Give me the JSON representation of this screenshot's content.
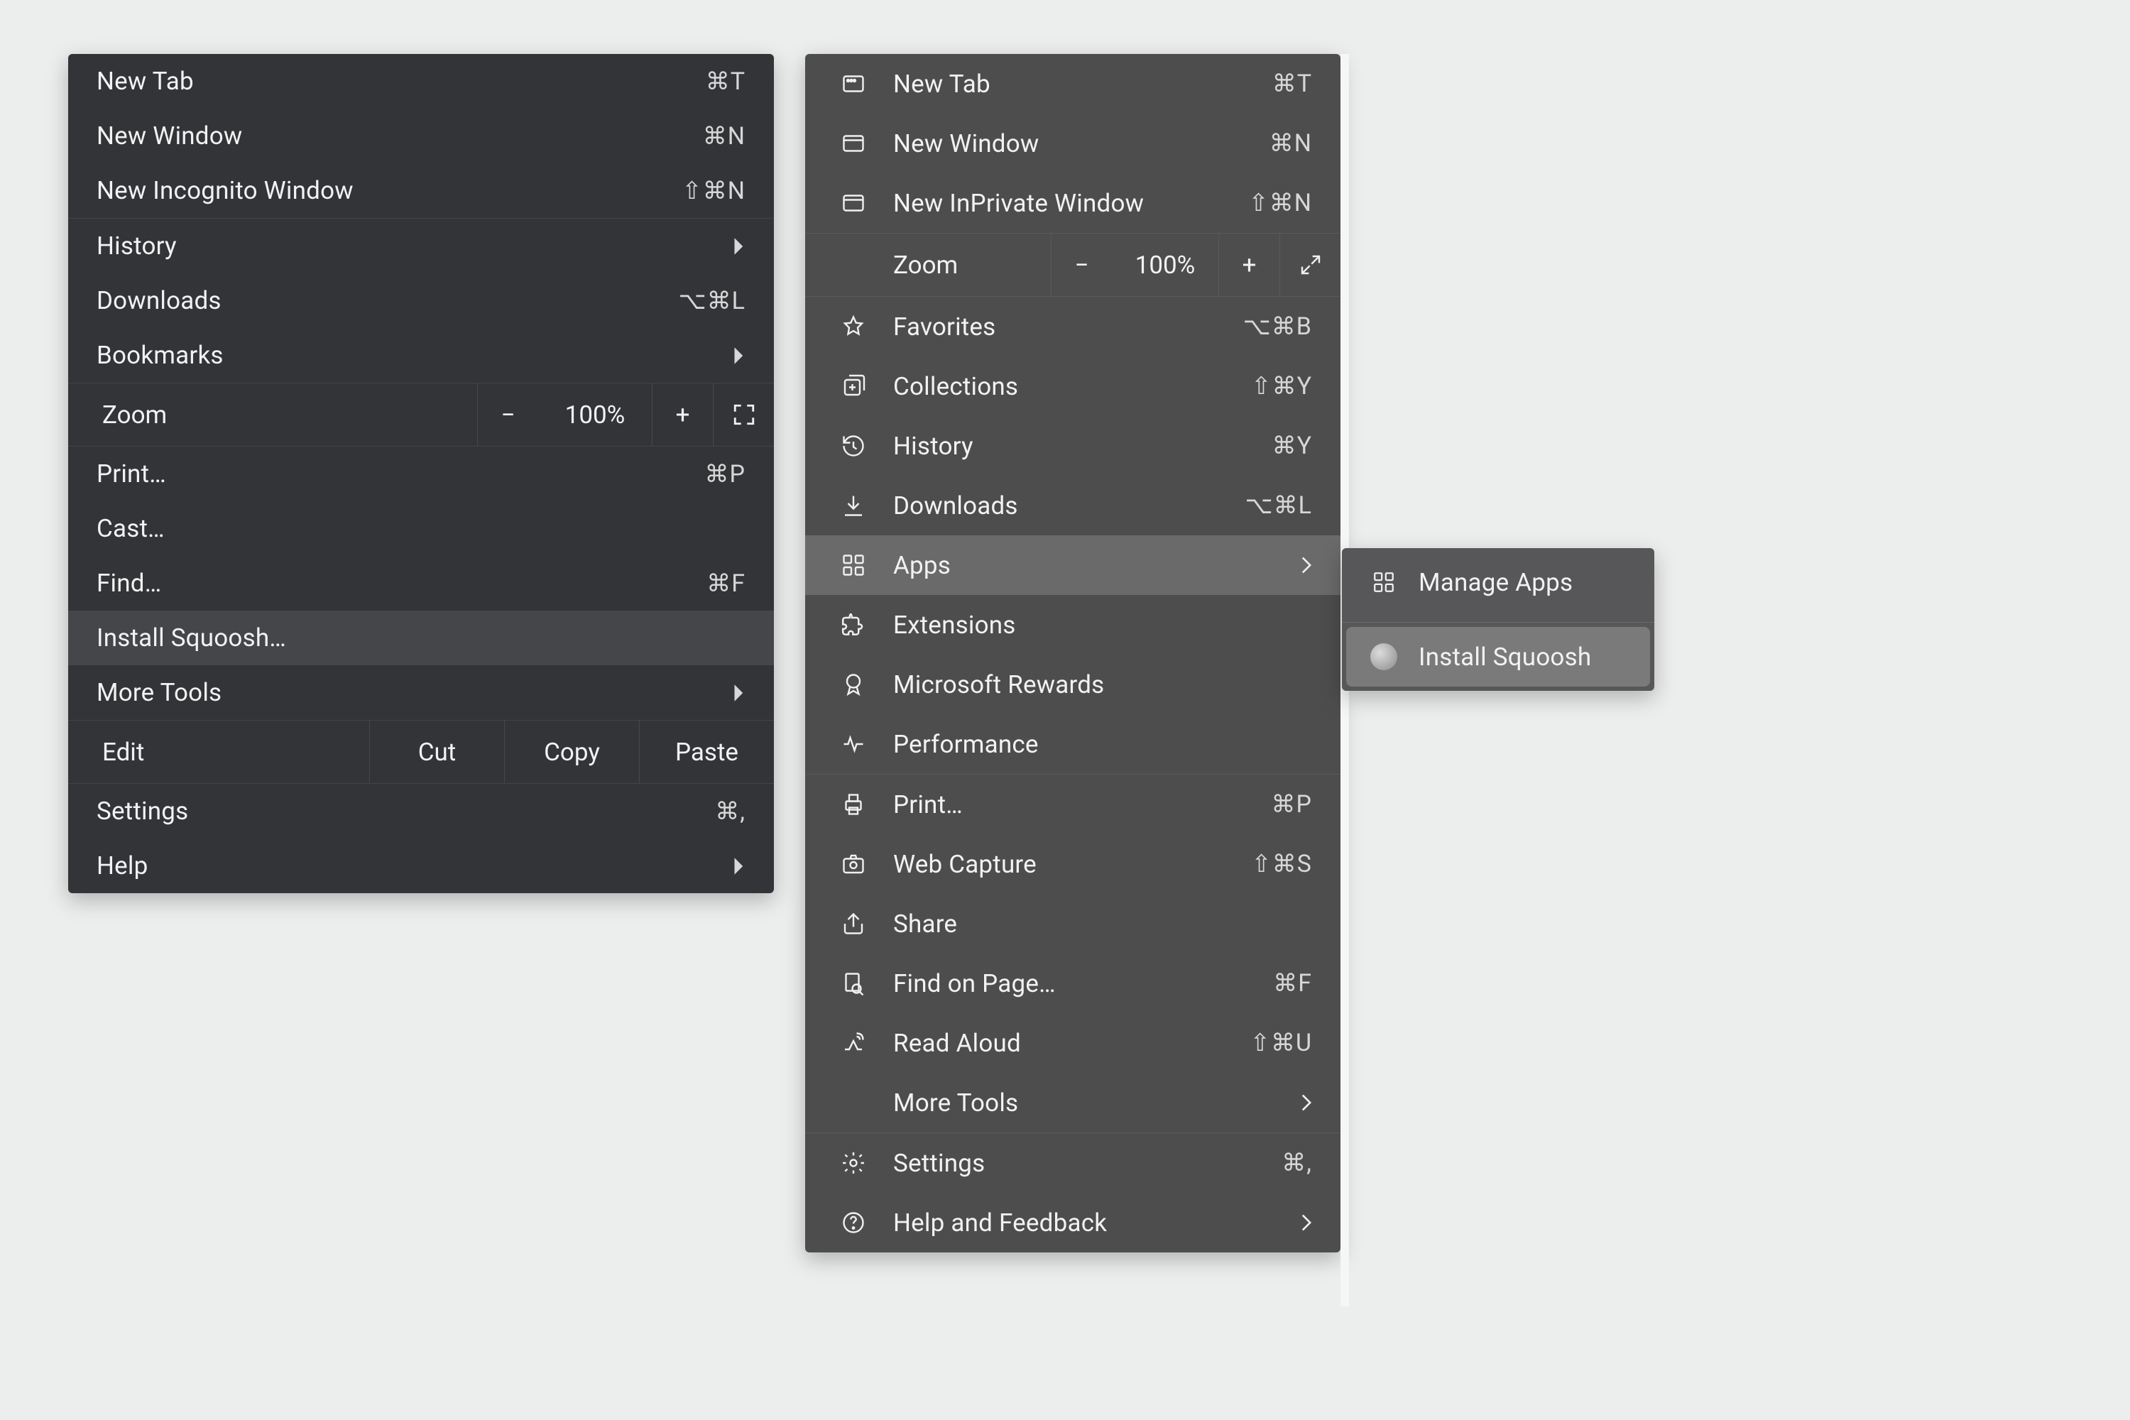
{
  "menu1": {
    "g1": [
      {
        "label": "New Tab",
        "shortcut": "⌘T"
      },
      {
        "label": "New Window",
        "shortcut": "⌘N"
      },
      {
        "label": "New Incognito Window",
        "shortcut": "⇧⌘N"
      }
    ],
    "g2": [
      {
        "label": "History",
        "chevron": true
      },
      {
        "label": "Downloads",
        "shortcut": "⌥⌘L"
      },
      {
        "label": "Bookmarks",
        "chevron": true
      }
    ],
    "zoom": {
      "label": "Zoom",
      "value": "100%",
      "minus": "−",
      "plus": "+"
    },
    "g3": [
      {
        "label": "Print…",
        "shortcut": "⌘P"
      },
      {
        "label": "Cast…"
      },
      {
        "label": "Find…",
        "shortcut": "⌘F"
      },
      {
        "label": "Install Squoosh…",
        "hover": true
      },
      {
        "label": "More Tools",
        "chevron": true
      }
    ],
    "edit": {
      "label": "Edit",
      "cut": "Cut",
      "copy": "Copy",
      "paste": "Paste"
    },
    "g4": [
      {
        "label": "Settings",
        "shortcut": "⌘,"
      },
      {
        "label": "Help",
        "chevron": true
      }
    ]
  },
  "menu2": {
    "g1": [
      {
        "icon": "newtab",
        "label": "New Tab",
        "shortcut": "⌘T"
      },
      {
        "icon": "window",
        "label": "New Window",
        "shortcut": "⌘N"
      },
      {
        "icon": "window",
        "label": "New InPrivate Window",
        "shortcut": "⇧⌘N"
      }
    ],
    "zoom": {
      "label": "Zoom",
      "value": "100%",
      "minus": "−",
      "plus": "+"
    },
    "g2": [
      {
        "icon": "star",
        "label": "Favorites",
        "shortcut": "⌥⌘B"
      },
      {
        "icon": "collections",
        "label": "Collections",
        "shortcut": "⇧⌘Y"
      },
      {
        "icon": "history",
        "label": "History",
        "shortcut": "⌘Y"
      },
      {
        "icon": "download",
        "label": "Downloads",
        "shortcut": "⌥⌘L"
      },
      {
        "icon": "apps",
        "label": "Apps",
        "chevron": true,
        "hover": true
      },
      {
        "icon": "ext",
        "label": "Extensions"
      },
      {
        "icon": "rewards",
        "label": "Microsoft Rewards"
      },
      {
        "icon": "perf",
        "label": "Performance"
      }
    ],
    "g3": [
      {
        "icon": "print",
        "label": "Print…",
        "shortcut": "⌘P"
      },
      {
        "icon": "capture",
        "label": "Web Capture",
        "shortcut": "⇧⌘S"
      },
      {
        "icon": "share",
        "label": "Share"
      },
      {
        "icon": "find",
        "label": "Find on Page…",
        "shortcut": "⌘F"
      },
      {
        "icon": "read",
        "label": "Read Aloud",
        "shortcut": "⇧⌘U"
      },
      {
        "icon": "none",
        "label": "More Tools",
        "chevron": true
      }
    ],
    "g4": [
      {
        "icon": "settings",
        "label": "Settings",
        "shortcut": "⌘,"
      },
      {
        "icon": "help",
        "label": "Help and Feedback",
        "chevron": true
      }
    ]
  },
  "menu3": {
    "manage": "Manage Apps",
    "install": "Install Squoosh"
  }
}
